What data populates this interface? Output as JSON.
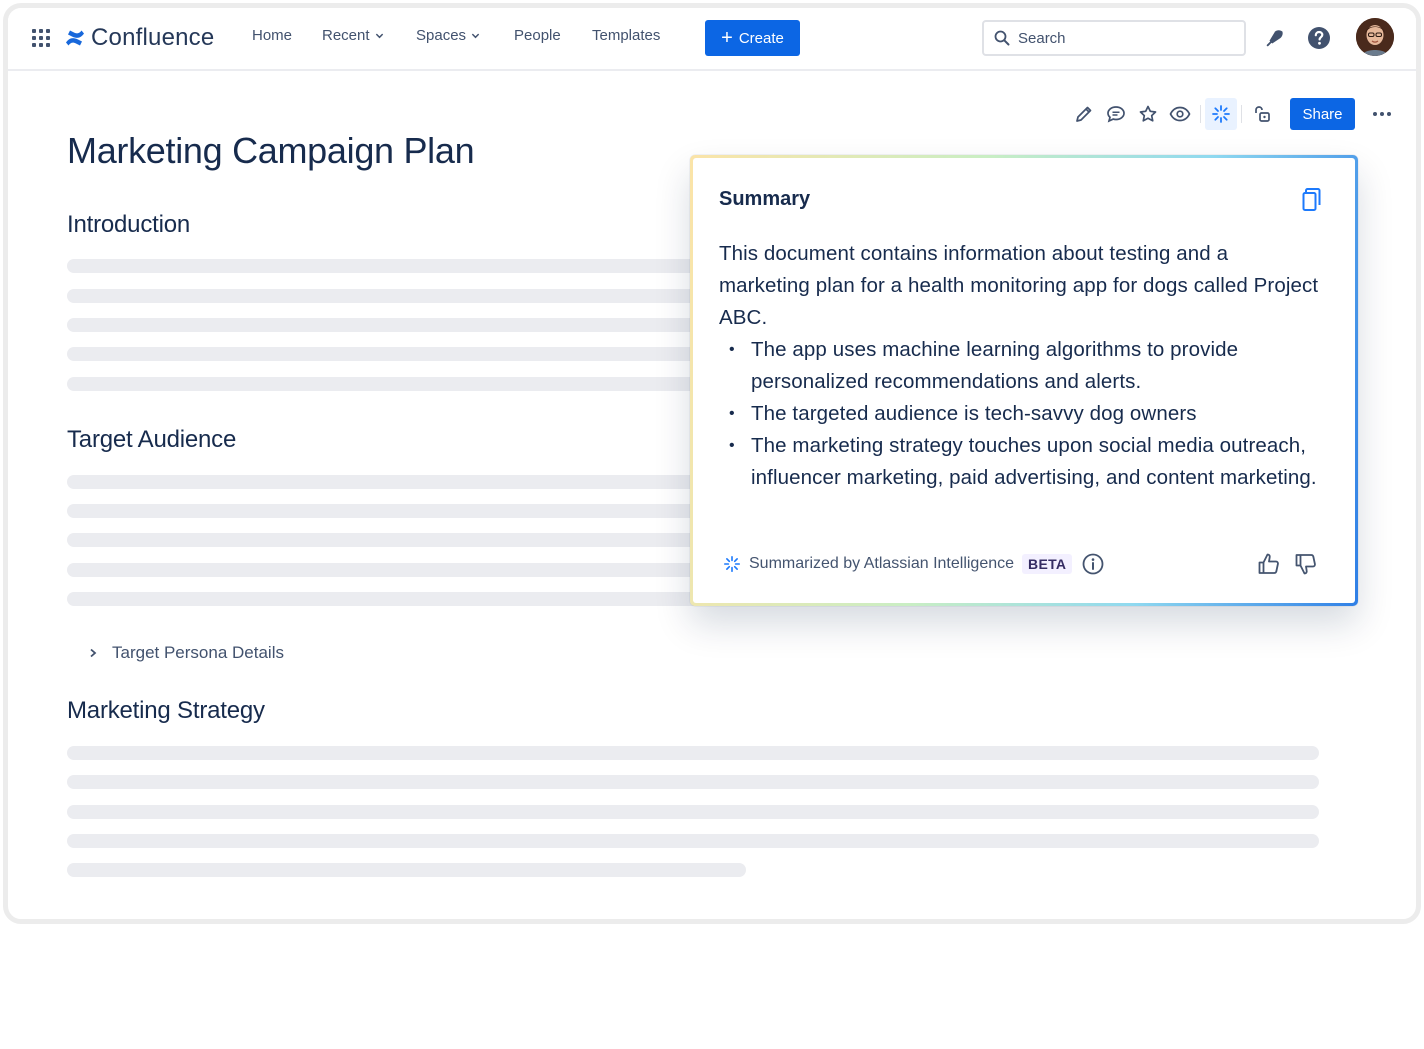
{
  "app": {
    "name": "Confluence"
  },
  "nav": {
    "items": [
      {
        "label": "Home"
      },
      {
        "label": "Recent"
      },
      {
        "label": "Spaces"
      },
      {
        "label": "People"
      },
      {
        "label": "Templates"
      }
    ],
    "create_label": "Create",
    "search_placeholder": "Search"
  },
  "toolbar": {
    "share_label": "Share"
  },
  "page": {
    "title": "Marketing Campaign Plan",
    "sections": [
      {
        "heading": "Introduction"
      },
      {
        "heading": "Target Audience"
      },
      {
        "heading": "Marketing Strategy"
      }
    ],
    "expand_label": "Target Persona Details"
  },
  "summary": {
    "title": "Summary",
    "intro": "This document contains information about testing and a marketing plan for a health monitoring app for dogs called Project ABC.",
    "bullets": [
      "The app uses machine learning algorithms to provide personalized recommendations and alerts.",
      "The targeted audience is tech-savvy dog owners",
      "The marketing strategy touches upon social media outreach, influencer marketing, paid advertising, and content marketing."
    ],
    "footer_label": "Summarized by Atlassian Intelligence",
    "badge": "BETA"
  },
  "colors": {
    "brand_blue": "#0c66e4",
    "text_primary": "#172b4d",
    "skeleton": "#ebecf0"
  }
}
